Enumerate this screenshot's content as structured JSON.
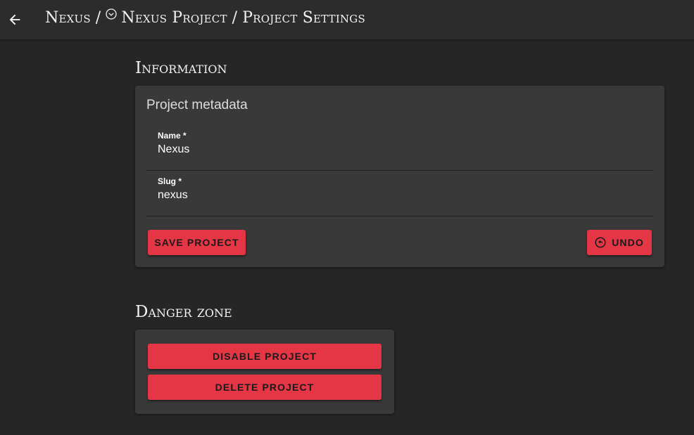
{
  "header": {
    "back_icon": "arrow-left-icon",
    "breadcrumbs": [
      {
        "label": "Nexus"
      },
      {
        "label": "Nexus Project",
        "icon": "chevron-down-circle-icon"
      },
      {
        "label": "Project Settings"
      }
    ],
    "separator": "/"
  },
  "information": {
    "title": "Information",
    "card_title": "Project metadata",
    "name_label": "Name *",
    "name_value": "Nexus",
    "slug_label": "Slug *",
    "slug_value": "nexus",
    "save_label": "SAVE PROJECT",
    "undo_label": "UNDO",
    "undo_icon": "undo-circle-icon"
  },
  "danger_zone": {
    "title": "Danger zone",
    "disable_label": "DISABLE PROJECT",
    "delete_label": "DELETE PROJECT"
  },
  "colors": {
    "background": "#262626",
    "appbar": "#2c2c2c",
    "card": "#393939",
    "accent": "#e53646"
  }
}
